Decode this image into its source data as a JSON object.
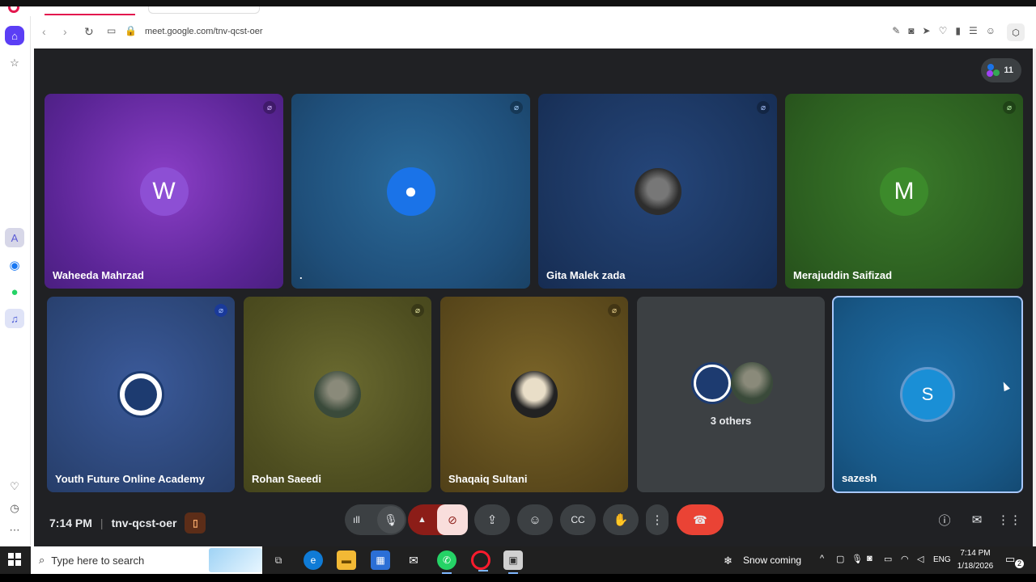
{
  "browser": {
    "url": "meet.google.com/tnv-qcst-oer"
  },
  "meeting": {
    "participant_count": "11",
    "time": "7:14 PM",
    "code": "tnv-qcst-oer",
    "others_label": "3 others"
  },
  "tiles": [
    {
      "name": "Waheeda Mahrzad",
      "initial": "W"
    },
    {
      "name": "."
    },
    {
      "name": "Gita Malek zada"
    },
    {
      "name": "Merajuddin Saifizad",
      "initial": "M"
    },
    {
      "name": "Youth Future Online Academy"
    },
    {
      "name": "Rohan Saeedi"
    },
    {
      "name": "Shaqaiq Sultani"
    },
    {
      "name": "sazesh",
      "initial": "S"
    }
  ],
  "taskbar": {
    "search_placeholder": "Type here to search",
    "weather": "Snow coming",
    "language": "ENG",
    "clock_time": "7:14 PM",
    "clock_date": "1/18/2026",
    "notifications": "2"
  },
  "colors": {
    "end_call": "#ea4335",
    "camera_off": "#f9dedc",
    "accent_opera": "#e3174e"
  }
}
